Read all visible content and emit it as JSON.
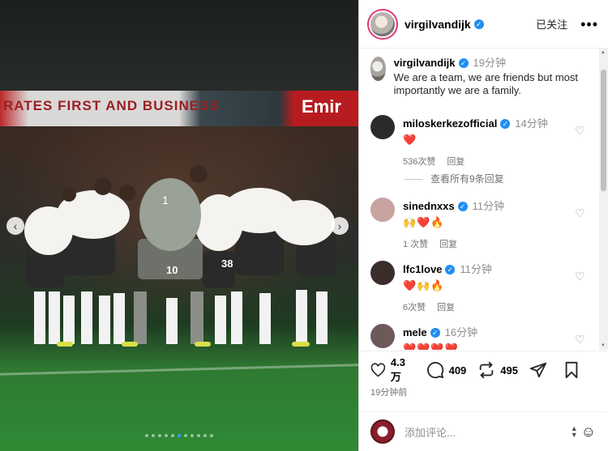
{
  "photo": {
    "banner_left_text": "RATES FIRST AND BUSINESS",
    "banner_right_text": "Emir",
    "jersey_number_1": "1",
    "jersey_number_2": "10",
    "jersey_number_3": "38",
    "prev_icon": "chevron-left-icon",
    "next_icon": "chevron-right-icon",
    "page_dots": 11,
    "active_dot": 5
  },
  "header": {
    "username": "virgilvandijk",
    "follow_label": "已关注",
    "more_label": "•••"
  },
  "caption": {
    "username": "virgilvandijk",
    "time": "19分钟",
    "text": "We are a team, we are friends but most importantly we are a family."
  },
  "comments": [
    {
      "username": "miloskerkezofficial",
      "time": "14分钟",
      "text": "❤️",
      "likes": "536次赞",
      "reply": "回复",
      "avatar_color": "#2b2b2b"
    },
    {
      "username": "sinednxxs",
      "time": "11分钟",
      "text": "🙌❤️🔥",
      "likes": "1 次赞",
      "reply": "回复",
      "avatar_color": "#c8a3a0"
    },
    {
      "username": "lfc1love",
      "time": "11分钟",
      "text": "❤️🙌🔥",
      "likes": "6次赞",
      "reply": "回复",
      "avatar_color": "#3b2e2a"
    },
    {
      "username": "mele",
      "time": "16分钟",
      "text": "❤️❤️❤️❤️",
      "likes": "",
      "reply": "",
      "avatar_color": "#6c5a58"
    }
  ],
  "view_replies": "查看所有9条回复",
  "actions": {
    "likes": "4.3 万",
    "comments": "409",
    "reposts": "495",
    "posted": "19分钟前"
  },
  "add_comment": {
    "placeholder": "添加评论..."
  },
  "colors": {
    "verified": "#1f8ef1",
    "story_ring": "#e1306c",
    "active_dot": "#2fa0ff"
  }
}
